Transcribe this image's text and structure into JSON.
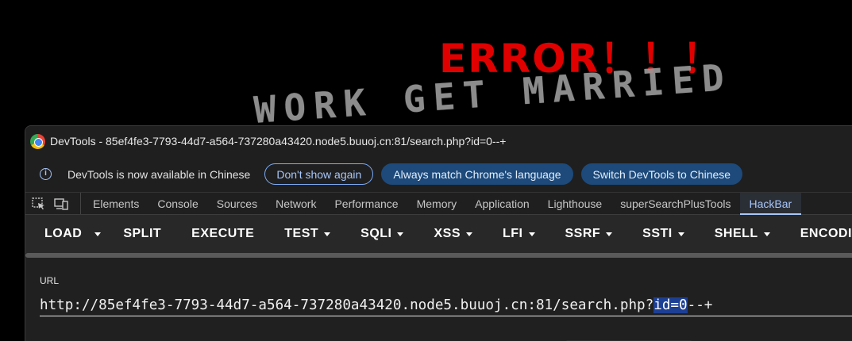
{
  "page": {
    "error_heading": "ERROR！！！",
    "motto_text": "WORK GET MARRIED"
  },
  "devtools": {
    "window_title": "DevTools - 85ef4fe3-7793-44d7-a564-737280a43420.node5.buuoj.cn:81/search.php?id=0--+",
    "infobar": {
      "message": "DevTools is now available in Chinese",
      "dont_show_label": "Don't show again",
      "match_language_label": "Always match Chrome's language",
      "switch_label": "Switch DevTools to Chinese"
    },
    "tabs": [
      {
        "label": "Elements"
      },
      {
        "label": "Console"
      },
      {
        "label": "Sources"
      },
      {
        "label": "Network"
      },
      {
        "label": "Performance"
      },
      {
        "label": "Memory"
      },
      {
        "label": "Application"
      },
      {
        "label": "Lighthouse"
      },
      {
        "label": "superSearchPlusTools"
      },
      {
        "label": "HackBar"
      }
    ],
    "active_tab": "HackBar"
  },
  "hackbar": {
    "buttons": {
      "load": "LOAD",
      "split": "SPLIT",
      "execute": "EXECUTE",
      "test": "TEST",
      "sqli": "SQLI",
      "xss": "XSS",
      "lfi": "LFI",
      "ssrf": "SSRF",
      "ssti": "SSTI",
      "shell": "SHELL",
      "encoding": "ENCODI"
    },
    "url_label": "URL",
    "url_prefix": "http://85ef4fe3-7793-44d7-a564-737280a43420.node5.buuoj.cn:81/search.php?",
    "url_selected": "id=0",
    "url_suffix": "--+"
  },
  "colors": {
    "error_red": "#e00000",
    "accent_blue": "#a8c7fa",
    "selection_blue": "#1c3f94"
  }
}
